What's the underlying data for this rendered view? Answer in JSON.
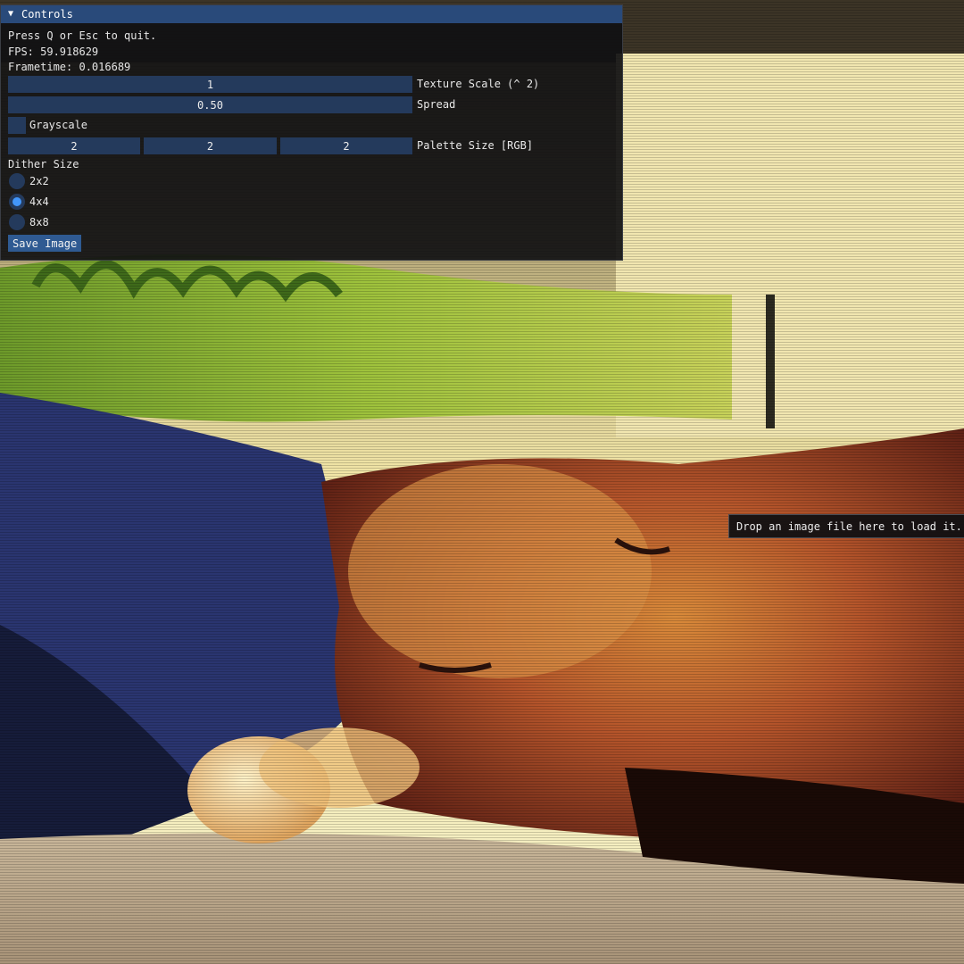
{
  "window": {
    "title": "Controls",
    "collapse_glyph": "▼",
    "help_text": "Press Q or Esc to quit.",
    "fps_text": "FPS: 59.918629",
    "frametime_text": "Frametime: 0.016689"
  },
  "controls": {
    "texture_scale": {
      "value": "1",
      "label": "Texture Scale (^ 2)"
    },
    "spread": {
      "value": "0.50",
      "label": "Spread"
    },
    "grayscale": {
      "label": "Grayscale",
      "checked": false
    },
    "palette_size": {
      "values": [
        "2",
        "2",
        "2"
      ],
      "label": "Palette Size [RGB]"
    },
    "dither_size": {
      "heading": "Dither Size",
      "options": [
        "2x2",
        "4x4",
        "8x8"
      ],
      "selected": "4x4"
    },
    "save_button": "Save Image"
  },
  "tooltip": {
    "text": "Drop an image file here to load it."
  },
  "colors": {
    "title_bar": "#294a7a",
    "frame_bg": "#243a5c",
    "accent": "#4296fa",
    "button": "#2f5a92"
  }
}
